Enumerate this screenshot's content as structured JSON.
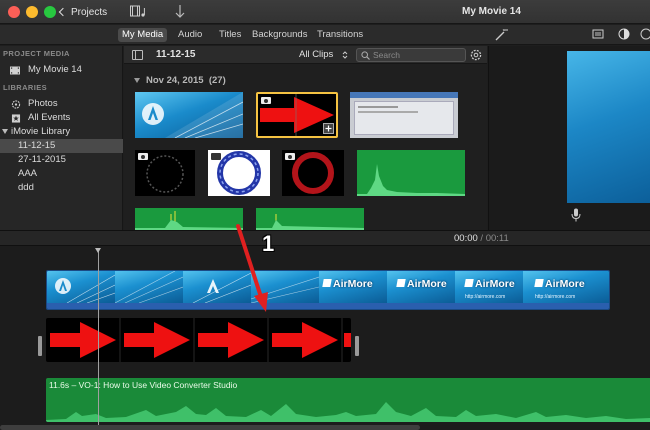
{
  "titlebar": {
    "projects_label": "Projects",
    "movie_title": "My Movie 14"
  },
  "tabs": [
    {
      "label": "My Media",
      "active": true
    },
    {
      "label": "Audio",
      "active": false
    },
    {
      "label": "Titles",
      "active": false
    },
    {
      "label": "Backgrounds",
      "active": false
    },
    {
      "label": "Transitions",
      "active": false
    }
  ],
  "sidebar": {
    "project_media_header": "PROJECT MEDIA",
    "project_item": "My Movie 14",
    "libraries_header": "LIBRARIES",
    "photos": "Photos",
    "all_events": "All Events",
    "library_name": "iMovie Library",
    "events": [
      {
        "label": "11-12-15",
        "selected": true
      },
      {
        "label": "27-11-2015",
        "selected": false
      },
      {
        "label": "AAA",
        "selected": false
      },
      {
        "label": "ddd",
        "selected": false
      }
    ]
  },
  "browser": {
    "event_name": "11-12-15",
    "filter": "All Clips",
    "search_placeholder": "Search",
    "date_group": "Nov 24, 2015",
    "date_count": "(27)"
  },
  "timeline": {
    "current_time": "00:00",
    "separator": "/",
    "duration": "00:11",
    "video_clip_brand": "AirMore",
    "video_clip_watermark": "http://airmore.com",
    "audio_clip_label": "11.6s – VO-1: How to Use Video Converter Studio"
  },
  "annotation": {
    "step_number": "1",
    "color": "#e02020"
  },
  "colors": {
    "accent_blue": "#1b90d0",
    "audio_green": "#1a8a39",
    "arrow_red": "#ee1111",
    "selected_border": "#f5c342"
  }
}
